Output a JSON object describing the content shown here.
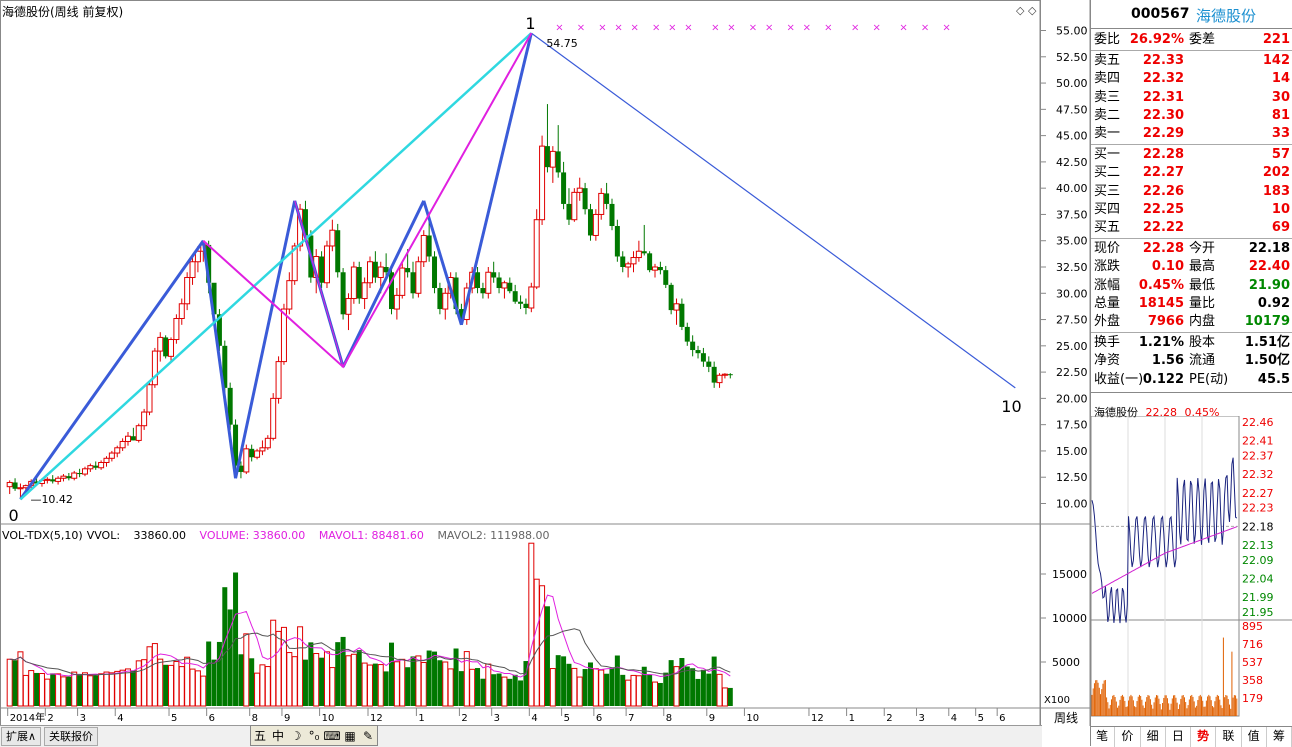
{
  "stock": {
    "code": "000567",
    "name": "海德股份",
    "title": "海德股份(周线 前复权)",
    "period": "周线"
  },
  "main_chart": {
    "y_ticks": [
      "55.00",
      "52.50",
      "50.00",
      "47.50",
      "45.00",
      "42.50",
      "40.00",
      "37.50",
      "35.00",
      "32.50",
      "30.00",
      "27.50",
      "25.00",
      "22.50",
      "20.00",
      "17.50",
      "15.00",
      "12.50",
      "10.00"
    ],
    "high_label": "54.75",
    "low_label": "10.42",
    "wave_labels": {
      "start": "0",
      "top": "1",
      "end": "10"
    },
    "x_labels": [
      "2014年",
      "2",
      "3",
      "4",
      "5",
      "6",
      "8",
      "9",
      "10",
      "12",
      "1",
      "2",
      "3",
      "4",
      "5",
      "6",
      "7",
      "8",
      "9",
      "10",
      "12",
      "1",
      "2",
      "3",
      "4",
      "5",
      "6"
    ],
    "x_label_weeks": [
      0,
      7,
      13,
      20,
      30,
      37,
      45,
      51,
      58,
      67,
      76,
      84,
      90,
      97,
      103,
      109,
      115,
      122,
      130,
      137,
      149,
      156,
      163,
      169,
      175,
      180,
      184
    ],
    "colors": {
      "up": "#e00000",
      "down": "#007800",
      "wave": "#3a5bd8",
      "cyan": "#2fd8e0",
      "magenta": "#e020e0"
    }
  },
  "chart_data": {
    "type": "candlestick",
    "weeks": 188,
    "bars": [
      [
        11.6,
        12.2,
        10.9,
        12.0
      ],
      [
        12.0,
        12.4,
        11.2,
        11.4
      ],
      [
        11.4,
        11.9,
        10.4,
        11.5
      ],
      [
        11.5,
        11.8,
        11.1,
        11.7
      ],
      [
        11.7,
        12.3,
        11.4,
        12.1
      ],
      [
        12.1,
        12.6,
        11.8,
        11.9
      ],
      [
        11.9,
        12.4,
        11.6,
        12.2
      ],
      [
        12.2,
        12.5,
        11.9,
        12.3
      ],
      [
        12.3,
        12.7,
        11.9,
        12.1
      ],
      [
        12.1,
        12.6,
        11.8,
        12.4
      ],
      [
        12.4,
        12.8,
        12.1,
        12.6
      ],
      [
        12.6,
        12.9,
        12.2,
        12.4
      ],
      [
        12.4,
        13.1,
        12.2,
        12.9
      ],
      [
        12.9,
        13.3,
        12.5,
        12.8
      ],
      [
        12.8,
        13.5,
        12.6,
        13.3
      ],
      [
        13.3,
        13.8,
        13.0,
        13.6
      ],
      [
        13.6,
        14.0,
        13.2,
        13.4
      ],
      [
        13.4,
        14.1,
        13.2,
        13.9
      ],
      [
        13.9,
        14.5,
        13.5,
        14.3
      ],
      [
        14.3,
        15.0,
        14.0,
        14.8
      ],
      [
        14.8,
        15.5,
        14.4,
        15.3
      ],
      [
        15.3,
        16.2,
        15.0,
        15.9
      ],
      [
        15.9,
        16.8,
        15.5,
        16.4
      ],
      [
        16.4,
        17.2,
        16.0,
        16.0
      ],
      [
        16.0,
        17.6,
        15.8,
        17.4
      ],
      [
        17.4,
        19.0,
        17.0,
        18.7
      ],
      [
        18.7,
        21.5,
        18.4,
        21.3
      ],
      [
        21.3,
        24.8,
        21.0,
        24.5
      ],
      [
        24.5,
        26.3,
        23.5,
        25.8
      ],
      [
        25.8,
        26.0,
        23.8,
        24.0
      ],
      [
        24.0,
        25.8,
        23.5,
        25.6
      ],
      [
        25.6,
        28.0,
        25.2,
        27.6
      ],
      [
        27.6,
        29.5,
        27.0,
        29.0
      ],
      [
        29.0,
        32.0,
        28.4,
        31.5
      ],
      [
        31.5,
        33.4,
        30.8,
        33.0
      ],
      [
        33.0,
        34.5,
        32.0,
        34.0
      ],
      [
        34.0,
        35.0,
        33.0,
        34.6
      ],
      [
        34.6,
        35.0,
        30.0,
        31.0
      ],
      [
        31.0,
        30.5,
        27.5,
        28.0
      ],
      [
        28.0,
        28.5,
        24.5,
        25.0
      ],
      [
        25.0,
        25.5,
        20.5,
        21.0
      ],
      [
        21.0,
        21.5,
        17.0,
        17.5
      ],
      [
        17.5,
        18.0,
        13.0,
        13.6
      ],
      [
        13.6,
        14.0,
        12.4,
        13.0
      ],
      [
        13.0,
        15.6,
        12.8,
        15.2
      ],
      [
        15.2,
        15.6,
        14.0,
        14.4
      ],
      [
        14.4,
        15.2,
        14.2,
        15.0
      ],
      [
        15.0,
        16.0,
        14.6,
        15.3
      ],
      [
        15.3,
        16.5,
        15.1,
        16.2
      ],
      [
        16.2,
        20.5,
        16.0,
        20.0
      ],
      [
        20.0,
        24.0,
        19.5,
        23.5
      ],
      [
        23.5,
        29.0,
        23.2,
        28.5
      ],
      [
        28.5,
        32.0,
        28.0,
        31.2
      ],
      [
        31.2,
        34.8,
        30.8,
        34.5
      ],
      [
        34.5,
        38.5,
        34.0,
        38.0
      ],
      [
        38.0,
        38.8,
        35.0,
        35.5
      ],
      [
        35.5,
        36.0,
        31.0,
        31.5
      ],
      [
        31.5,
        34.2,
        30.0,
        33.5
      ],
      [
        33.5,
        34.0,
        30.5,
        31.0
      ],
      [
        31.0,
        35.0,
        30.5,
        34.5
      ],
      [
        34.5,
        37.0,
        34.0,
        36.0
      ],
      [
        36.0,
        36.6,
        31.5,
        32.0
      ],
      [
        32.0,
        32.4,
        27.5,
        28.0
      ],
      [
        28.0,
        30.0,
        26.5,
        29.5
      ],
      [
        29.5,
        33.0,
        29.0,
        32.5
      ],
      [
        32.5,
        33.0,
        29.0,
        29.5
      ],
      [
        29.5,
        31.5,
        28.5,
        31.0
      ],
      [
        31.0,
        33.5,
        30.5,
        33.0
      ],
      [
        33.0,
        34.0,
        31.0,
        31.5
      ],
      [
        31.5,
        33.0,
        30.0,
        32.5
      ],
      [
        32.5,
        33.8,
        31.5,
        32.0
      ],
      [
        32.0,
        32.5,
        28.0,
        28.5
      ],
      [
        28.5,
        30.5,
        27.5,
        29.8
      ],
      [
        29.8,
        33.0,
        29.5,
        32.4
      ],
      [
        32.4,
        34.2,
        31.5,
        32.0
      ],
      [
        32.0,
        33.0,
        29.5,
        30.0
      ],
      [
        30.0,
        33.5,
        29.6,
        33.0
      ],
      [
        33.0,
        36.0,
        32.5,
        35.5
      ],
      [
        35.5,
        37.5,
        33.0,
        33.5
      ],
      [
        33.5,
        34.0,
        30.0,
        30.5
      ],
      [
        30.5,
        31.0,
        28.0,
        28.5
      ],
      [
        28.5,
        30.5,
        27.5,
        30.0
      ],
      [
        30.0,
        32.0,
        29.5,
        31.5
      ],
      [
        31.5,
        32.0,
        28.0,
        28.5
      ],
      [
        28.5,
        29.0,
        27.0,
        27.5
      ],
      [
        27.5,
        31.0,
        27.0,
        30.5
      ],
      [
        30.5,
        32.5,
        30.0,
        32.0
      ],
      [
        32.0,
        32.5,
        30.0,
        30.5
      ],
      [
        30.5,
        31.0,
        29.5,
        30.0
      ],
      [
        30.0,
        32.5,
        29.5,
        32.0
      ],
      [
        32.0,
        33.0,
        31.0,
        31.5
      ],
      [
        31.5,
        32.0,
        30.0,
        30.5
      ],
      [
        30.5,
        31.2,
        29.5,
        31.0
      ],
      [
        31.0,
        31.5,
        30.0,
        30.2
      ],
      [
        30.2,
        30.8,
        29.0,
        29.2
      ],
      [
        29.2,
        29.8,
        28.5,
        29.0
      ],
      [
        29.0,
        29.5,
        28.0,
        28.6
      ],
      [
        28.6,
        31.0,
        28.2,
        30.6
      ],
      [
        30.6,
        38.0,
        30.4,
        37.0
      ],
      [
        37.0,
        45.0,
        36.5,
        44.0
      ],
      [
        44.0,
        48.0,
        41.5,
        42.0
      ],
      [
        42.0,
        44.0,
        40.5,
        43.5
      ],
      [
        43.5,
        46.0,
        41.0,
        41.5
      ],
      [
        41.5,
        42.5,
        38.0,
        38.5
      ],
      [
        38.5,
        40.0,
        36.5,
        37.0
      ],
      [
        37.0,
        40.0,
        36.8,
        39.6
      ],
      [
        39.6,
        41.0,
        38.8,
        40.0
      ],
      [
        40.0,
        40.5,
        37.5,
        38.0
      ],
      [
        38.0,
        38.5,
        35.0,
        35.5
      ],
      [
        35.5,
        38.0,
        35.0,
        37.5
      ],
      [
        37.5,
        40.0,
        37.0,
        39.5
      ],
      [
        39.5,
        40.5,
        38.0,
        38.5
      ],
      [
        38.5,
        39.0,
        36.0,
        36.4
      ],
      [
        36.4,
        37.0,
        33.0,
        33.5
      ],
      [
        33.5,
        34.0,
        32.0,
        32.5
      ],
      [
        32.5,
        33.0,
        31.5,
        32.8
      ],
      [
        32.8,
        34.0,
        32.0,
        33.4
      ],
      [
        33.4,
        35.0,
        33.0,
        34.0
      ],
      [
        34.0,
        36.5,
        33.6,
        33.8
      ],
      [
        33.8,
        34.0,
        32.0,
        32.2
      ],
      [
        32.2,
        32.8,
        31.5,
        32.5
      ],
      [
        32.5,
        33.0,
        31.8,
        32.2
      ],
      [
        32.2,
        32.6,
        30.5,
        30.8
      ],
      [
        30.8,
        31.0,
        28.0,
        28.4
      ],
      [
        28.4,
        29.5,
        27.0,
        29.0
      ],
      [
        29.0,
        29.5,
        26.5,
        26.8
      ],
      [
        26.8,
        27.2,
        25.0,
        25.4
      ],
      [
        25.4,
        26.0,
        24.0,
        24.6
      ],
      [
        24.6,
        25.0,
        23.8,
        24.3
      ],
      [
        24.3,
        24.8,
        23.0,
        23.5
      ],
      [
        23.5,
        24.0,
        22.5,
        23.0
      ],
      [
        23.0,
        23.5,
        21.0,
        21.5
      ],
      [
        21.5,
        22.4,
        21.0,
        22.2
      ],
      [
        22.2,
        22.4,
        21.9,
        22.3
      ],
      [
        22.3,
        22.4,
        21.9,
        22.28
      ]
    ],
    "ylim": [
      9.0,
      56.0
    ],
    "high": 54.75,
    "low": 10.42,
    "volume": {
      "title": "VOL-TDX(5,10)",
      "vvol": "33860.00",
      "volume_label": "VOLUME: 33860.00",
      "mavol1_label": "MAVOL1: 88481.60",
      "mavol2_label": "MAVOL2: 111988.00",
      "y_ticks": [
        "15000",
        "10000",
        "5000"
      ],
      "unit_label": "X100",
      "ylim": [
        0,
        20000
      ]
    }
  },
  "quote_panel": {
    "header_code": "000567",
    "header_name": "海德股份",
    "weibi": {
      "label": "委比",
      "value": "26.92%",
      "label2": "委差",
      "value2": "221"
    },
    "asks": [
      {
        "label": "卖五",
        "price": "22.33",
        "vol": "142"
      },
      {
        "label": "卖四",
        "price": "22.32",
        "vol": "14"
      },
      {
        "label": "卖三",
        "price": "22.31",
        "vol": "30"
      },
      {
        "label": "卖二",
        "price": "22.30",
        "vol": "81"
      },
      {
        "label": "卖一",
        "price": "22.29",
        "vol": "33"
      }
    ],
    "bids": [
      {
        "label": "买一",
        "price": "22.28",
        "vol": "57"
      },
      {
        "label": "买二",
        "price": "22.27",
        "vol": "202"
      },
      {
        "label": "买三",
        "price": "22.26",
        "vol": "183"
      },
      {
        "label": "买四",
        "price": "22.25",
        "vol": "10"
      },
      {
        "label": "买五",
        "price": "22.22",
        "vol": "69"
      }
    ],
    "stats": [
      {
        "l1": "现价",
        "v1": "22.28",
        "c1": "red",
        "l2": "今开",
        "v2": "22.18",
        "c2": "blk"
      },
      {
        "l1": "涨跌",
        "v1": "0.10",
        "c1": "red",
        "l2": "最高",
        "v2": "22.40",
        "c2": "red"
      },
      {
        "l1": "涨幅",
        "v1": "0.45%",
        "c1": "red",
        "l2": "最低",
        "v2": "21.90",
        "c2": "green"
      },
      {
        "l1": "总量",
        "v1": "18145",
        "c1": "red",
        "l2": "量比",
        "v2": "0.92",
        "c2": "blk"
      },
      {
        "l1": "外盘",
        "v1": "7966",
        "c1": "red",
        "l2": "内盘",
        "v2": "10179",
        "c2": "green"
      }
    ],
    "fundamentals": [
      {
        "l1": "换手",
        "v1": "1.21%",
        "l2": "股本",
        "v2": "1.51亿"
      },
      {
        "l1": "净资",
        "v1": "1.56",
        "l2": "流通",
        "v2": "1.50亿"
      },
      {
        "l1": "收益(一)",
        "v1": "0.122",
        "l2": "PE(动)",
        "v2": "45.5"
      }
    ]
  },
  "intraday": {
    "name": "海德股份",
    "price": "22.28",
    "pct": "0.45%",
    "price_ticks": [
      "22.46",
      "22.41",
      "22.37",
      "22.32",
      "22.27",
      "22.23",
      "22.18",
      "22.13",
      "22.09",
      "22.04",
      "21.99",
      "21.95"
    ],
    "vol_ticks": [
      "895",
      "716",
      "537",
      "358",
      "179"
    ],
    "prev_close": 22.18
  },
  "toolbar": {
    "expand": "扩展∧",
    "related": "关联报价"
  },
  "tool_icons": [
    "五",
    "中",
    "☽",
    "°₀",
    "▦",
    "⌨",
    "✎"
  ],
  "bottom_tabs": [
    "笔",
    "价",
    "细",
    "日",
    "势",
    "联",
    "值",
    "筹"
  ],
  "active_tab": "势"
}
